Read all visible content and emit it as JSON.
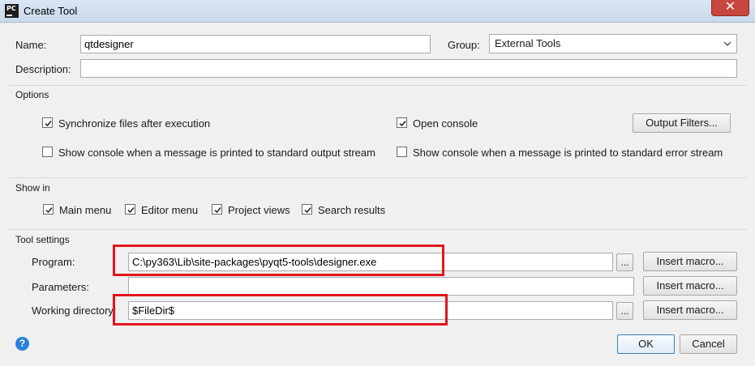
{
  "window": {
    "title": "Create Tool",
    "close_symbol": "✕",
    "icon": "pc-app-icon"
  },
  "general": {
    "name_label": "Name:",
    "name_value": "qtdesigner",
    "group_label": "Group:",
    "group_value": "External Tools",
    "description_label": "Description:",
    "description_value": ""
  },
  "options": {
    "section_title": "Options",
    "sync_files_label": "Synchronize files after execution",
    "sync_files_checked": true,
    "open_console_label": "Open console",
    "open_console_checked": true,
    "output_filters_label": "Output Filters...",
    "show_console_stdout_label": "Show console when a message is printed to standard output stream",
    "show_console_stdout_checked": false,
    "show_console_stderr_label": "Show console when a message is printed to standard error stream",
    "show_console_stderr_checked": false
  },
  "show_in": {
    "section_title": "Show in",
    "items": [
      {
        "label": "Main menu",
        "checked": true
      },
      {
        "label": "Editor menu",
        "checked": true
      },
      {
        "label": "Project views",
        "checked": true
      },
      {
        "label": "Search results",
        "checked": true
      }
    ]
  },
  "tool_settings": {
    "section_title": "Tool settings",
    "program_label": "Program:",
    "program_value": "C:\\py363\\Lib\\site-packages\\pyqt5-tools\\designer.exe",
    "parameters_label": "Parameters:",
    "parameters_value": "",
    "working_dir_label": "Working directory:",
    "working_dir_value": "$FileDir$",
    "browse_label": "...",
    "insert_macro_label": "Insert macro..."
  },
  "footer": {
    "help_symbol": "?",
    "ok_label": "OK",
    "cancel_label": "Cancel"
  },
  "colors": {
    "highlight": "#e1161c",
    "help_blue": "#2b80d9"
  }
}
